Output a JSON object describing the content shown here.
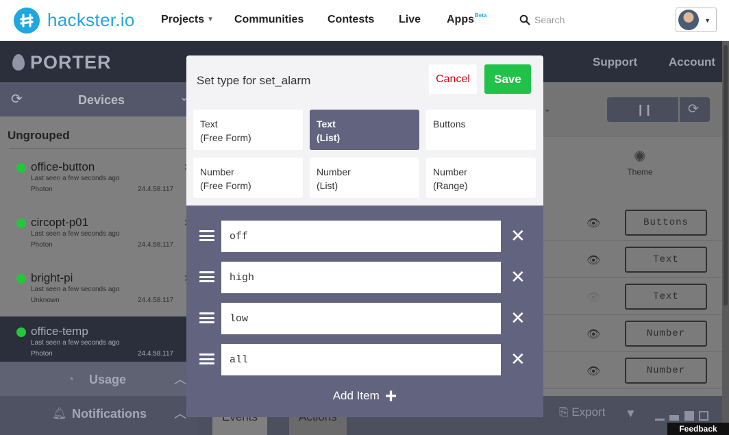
{
  "site": {
    "logo_text": "hackster.io",
    "nav": [
      {
        "label": "Projects",
        "has_caret": true
      },
      {
        "label": "Communities"
      },
      {
        "label": "Contests"
      },
      {
        "label": "Live"
      },
      {
        "label": "Apps",
        "badge": "Beta"
      }
    ],
    "search_placeholder": "Search",
    "brand_color": "#1fa7e0"
  },
  "app": {
    "name": "PORTER",
    "header_links": [
      "Support",
      "Account"
    ],
    "devices_label": "Devices",
    "group_label": "Ungrouped",
    "devices": [
      {
        "name": "office-button",
        "seen": "Last seen a few seconds ago",
        "kind": "Photon",
        "ip": "24.4.58.117",
        "online": true,
        "selected": false
      },
      {
        "name": "circopt-p01",
        "seen": "Last seen a few seconds ago",
        "kind": "Photon",
        "ip": "24.4.58.117",
        "online": true,
        "selected": false
      },
      {
        "name": "bright-pi",
        "seen": "Last seen a few seconds ago",
        "kind": "Unknown",
        "ip": "24.4.58.117",
        "online": true,
        "selected": false
      },
      {
        "name": "office-temp",
        "seen": "Last seen a few seconds ago",
        "kind": "Photon",
        "ip": "24.4.58.117",
        "online": true,
        "selected": true
      }
    ],
    "usage_label": "Usage",
    "notifications_label": "Notifications",
    "theme_label": "Theme",
    "variable_rows": [
      {
        "type": "Buttons",
        "visible": true
      },
      {
        "type": "Text",
        "visible": true
      },
      {
        "type": "Text",
        "visible": false
      },
      {
        "type": "Number",
        "visible": true
      },
      {
        "type": "Number",
        "visible": true
      }
    ],
    "bottom_tabs": [
      "Events",
      "Actions"
    ],
    "export_label": "Export",
    "feedback_label": "Feedback"
  },
  "modal": {
    "title": "Set type for set_alarm",
    "cancel_label": "Cancel",
    "save_label": "Save",
    "type_options": [
      {
        "line1": "Text",
        "line2": "(Free Form)",
        "selected": false
      },
      {
        "line1": "Text",
        "line2": "(List)",
        "selected": true
      },
      {
        "line1": "Buttons",
        "line2": "",
        "selected": false
      },
      {
        "line1": "Number",
        "line2": "(Free Form)",
        "selected": false
      },
      {
        "line1": "Number",
        "line2": "(List)",
        "selected": false
      },
      {
        "line1": "Number",
        "line2": "(Range)",
        "selected": false
      }
    ],
    "list_items": [
      "off",
      "high",
      "low",
      "all"
    ],
    "add_item_label": "Add Item",
    "colors": {
      "panel": "#62647f",
      "save": "#21c24a",
      "cancel_text": "#d0021b"
    }
  }
}
